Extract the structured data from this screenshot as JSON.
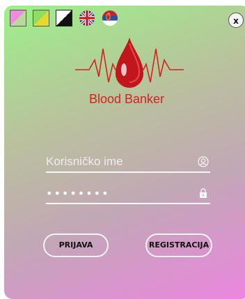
{
  "header": {
    "themes": [
      "pink-green-theme",
      "green-yellow-theme",
      "black-white-theme"
    ],
    "languages": [
      "english-flag-icon",
      "serbian-flag-icon"
    ],
    "close_label": "x"
  },
  "logo": {
    "icon": "blood-drop-heartbeat-logo",
    "accent": "#d32222"
  },
  "app_title": "Blood Banker",
  "form": {
    "username_placeholder": "Korisničko ime",
    "username_value": "",
    "password_value": "••••••••",
    "user_icon": "user-icon",
    "lock_icon": "lock-icon"
  },
  "buttons": {
    "login": "PRIJAVA",
    "register": "REGISTRACIJA"
  },
  "colors": {
    "gradient_top": "#9df08a",
    "gradient_bottom": "#ec86e0",
    "title": "#d32222"
  }
}
